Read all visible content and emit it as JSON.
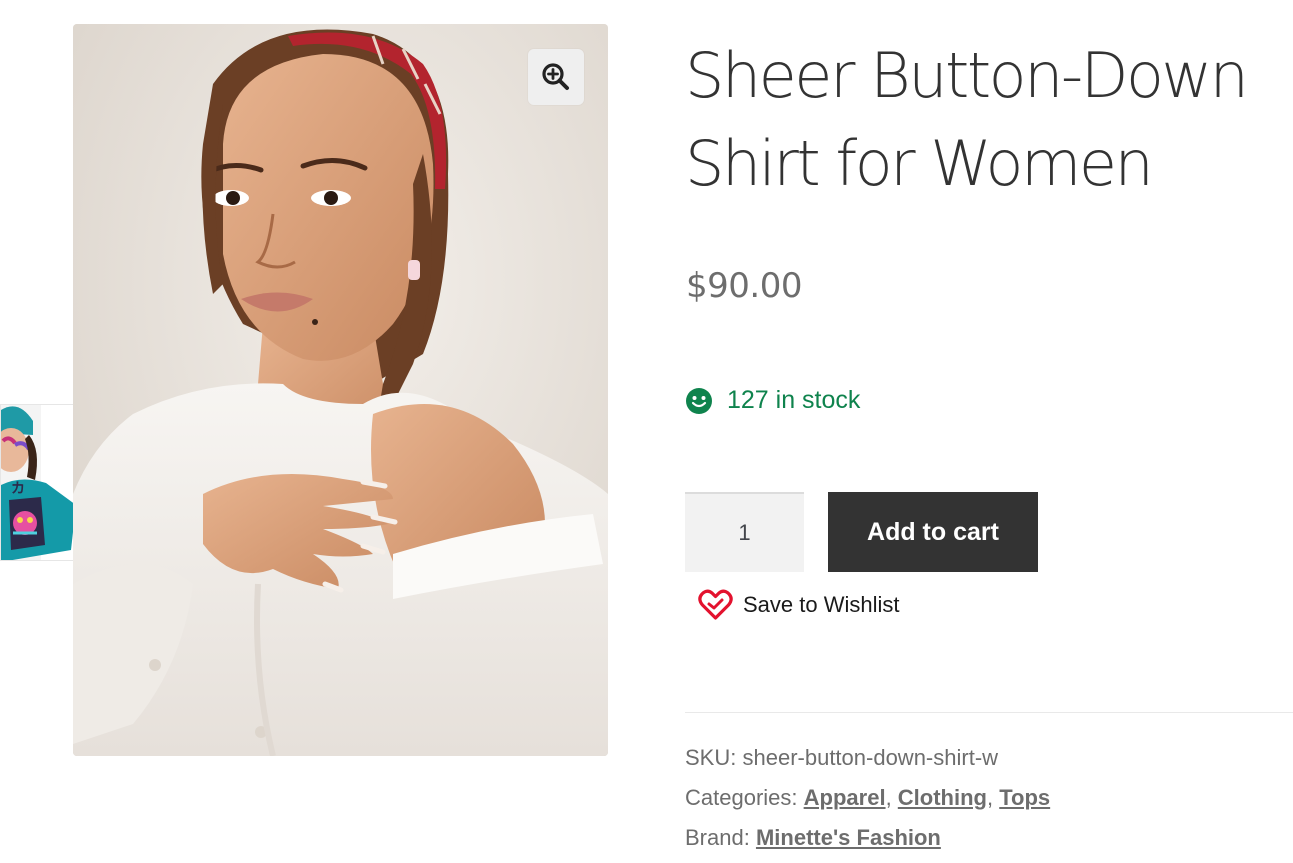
{
  "product": {
    "title_line1": "Sheer Button-Down",
    "title_line2": "Shirt for Women",
    "price": "$90.00",
    "stock_text": "127 in stock"
  },
  "gallery": {
    "zoom_icon": "zoom-in-icon",
    "thumbnail_icon": "product-thumbnail"
  },
  "cart": {
    "quantity_value": "1",
    "add_to_cart_label": "Add to cart"
  },
  "wishlist": {
    "label": "Save to Wishlist",
    "icon": "heart-icon"
  },
  "meta": {
    "sku_label": "SKU:",
    "sku_value": "sheer-button-down-shirt-w",
    "categories_label": "Categories:",
    "categories": [
      "Apparel",
      "Clothing",
      "Tops"
    ],
    "brand_label": "Brand:",
    "brand_value": "Minette's Fashion"
  },
  "colors": {
    "stock_green": "#0f834d",
    "button_dark": "#333333",
    "heart_red": "#e3122e",
    "text_gray": "#6d6d6d"
  }
}
